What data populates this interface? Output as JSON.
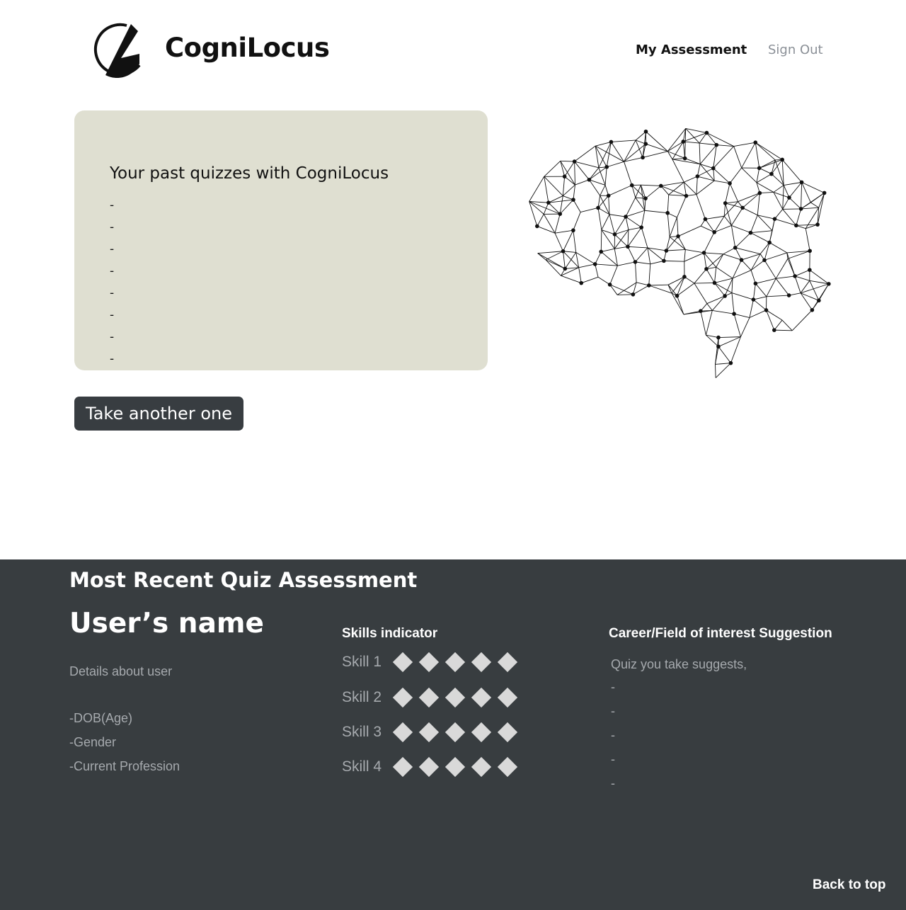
{
  "header": {
    "brand": "CogniLocus",
    "nav": {
      "my_assessment": "My Assessment",
      "sign_out": "Sign Out"
    }
  },
  "quiz_card": {
    "title": "Your past quizzes with CogniLocus",
    "items": [
      "-",
      "-",
      "-",
      "-",
      "-",
      "-",
      "-",
      "-"
    ]
  },
  "take_button": "Take another one",
  "recent": {
    "section_title": "Most Recent Quiz Assessment",
    "user_name": "User’s name",
    "details_label": "Details about user",
    "fields": [
      "-DOB(Age)",
      "-Gender",
      "-Current Profession"
    ],
    "skills_title": "Skills indicator",
    "skills": [
      {
        "label": "Skill 1",
        "rating": 0
      },
      {
        "label": "Skill 2",
        "rating": 0
      },
      {
        "label": "Skill 3",
        "rating": 0
      },
      {
        "label": "Skill 4",
        "rating": 0
      }
    ],
    "career_title": "Career/Field of interest Suggestion",
    "career_intro": "Quiz you take suggests,",
    "career_items": [
      "-",
      "-",
      "-",
      "-",
      "-"
    ]
  },
  "back_to_top": "Back to top",
  "colors": {
    "card_bg": "#dfdfd1",
    "dark_bg": "#383d40",
    "button_bg": "#383d41",
    "muted_text": "#a6aaae",
    "diamond": "#d9d9d9"
  }
}
